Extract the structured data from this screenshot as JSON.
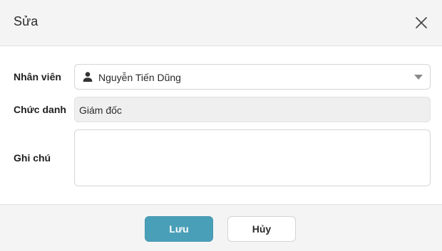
{
  "dialog": {
    "title": "Sửa",
    "close_icon": "close-icon"
  },
  "form": {
    "employee": {
      "label": "Nhân viên",
      "value": "Nguyễn Tiến Dũng",
      "icon": "user-icon"
    },
    "position": {
      "label": "Chức danh",
      "value": "Giám đốc"
    },
    "note": {
      "label": "Ghi chú",
      "value": ""
    }
  },
  "footer": {
    "save_label": "Lưu",
    "cancel_label": "Hủy"
  },
  "colors": {
    "primary": "#4a9fb8",
    "header_bg": "#f4f4f4",
    "readonly_bg": "#efefef"
  }
}
